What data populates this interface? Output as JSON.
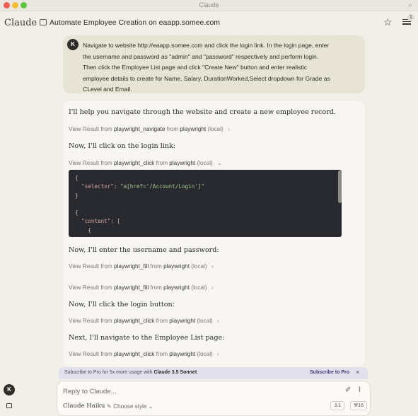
{
  "window": {
    "title": "Claude"
  },
  "header": {
    "brand": "Claude",
    "chat_title": "Automate Employee Creation on eaapp.somee.com",
    "badge_count": "1"
  },
  "user_message": {
    "avatar": "K",
    "lines": [
      "Navigate to website http://eaapp.somee.com and click the login link. In the login page, enter",
      "the username and password as \"admin\" and \"password\" respectively and perform login.",
      "Then click the Employee List page and click \"Create New\" button and enter realistic",
      "employee details to create for Name, Salary, DurationWorked,Select dropdown for Grade as",
      "CLevel and Email."
    ]
  },
  "assistant": {
    "intro": "I'll help you navigate through the website and create a new employee record.",
    "tool_prefix": "View Result from",
    "tool_from": "from",
    "tool_server": "playwright",
    "tool_local": "(local)",
    "steps": [
      {
        "tool": "playwright_navigate",
        "arrow": "›"
      },
      {
        "tool": "playwright_click",
        "arrow": "⌄"
      },
      {
        "tool": "playwright_fill",
        "arrow": "›"
      },
      {
        "tool": "playwright_fill",
        "arrow": "›"
      },
      {
        "tool": "playwright_click",
        "arrow": "›"
      },
      {
        "tool": "playwright_click",
        "arrow": "›"
      }
    ],
    "messages": [
      "Now, I'll click on the login link:",
      "Now, I'll enter the username and password:",
      "Now, I'll click the login button:",
      "Next, I'll navigate to the Employee List page:"
    ],
    "code": {
      "open_brace": "{",
      "selector_key": "\"selector\"",
      "selector_val": "\"a[href='/Account/Login']\"",
      "close_brace": "}",
      "open_brace2": "{",
      "content_key": "\"content\"",
      "content_open": "[",
      "inner_open": "{"
    }
  },
  "banner": {
    "text": "Subscribe to Pro for 5x more usage with",
    "model": "Claude 3.5 Sonnet",
    "link": "Subscribe to Pro",
    "close": "×"
  },
  "composer": {
    "placeholder": "Reply to Claude...",
    "model": "Claude Haiku",
    "style": "Choose style",
    "pill_people": "1",
    "pill_tools": "16"
  },
  "sidebar": {
    "avatar": "K"
  },
  "icons": [
    "chat-bubble-icon",
    "chevron-down-icon",
    "star-icon",
    "sliders-icon",
    "search-icon",
    "wand-icon",
    "paperclip-icon",
    "brush-icon",
    "person-icon",
    "tools-icon",
    "sidebar-toggle-icon"
  ]
}
